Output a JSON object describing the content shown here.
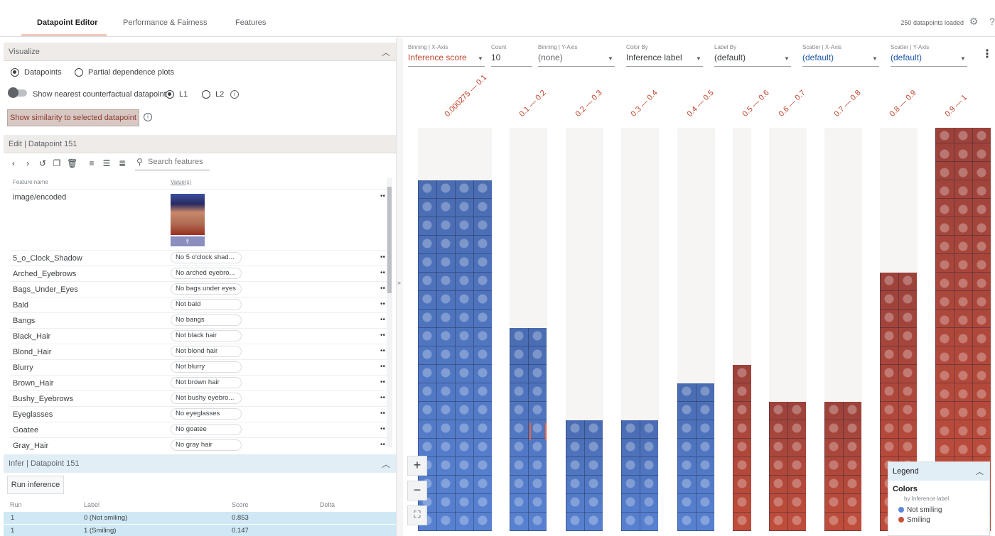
{
  "tabs": [
    "Datapoint Editor",
    "Performance & Fairness",
    "Features"
  ],
  "header": {
    "loaded": "250 datapoints loaded"
  },
  "visualize": {
    "title": "Visualize",
    "mode_datapoints": "Datapoints",
    "mode_pdp": "Partial dependence plots",
    "nearest_label": "Show nearest counterfactual datapoint",
    "l1": "L1",
    "l2": "L2",
    "similarity_button": "Show similarity to selected datapoint"
  },
  "edit": {
    "title": "Edit | Datapoint 151",
    "search_placeholder": "Search features",
    "col_name": "Feature name",
    "col_value": "Value(s)",
    "image_feature": "image/encoded",
    "features": [
      {
        "name": "5_o_Clock_Shadow",
        "value": "No 5 o'clock shad..."
      },
      {
        "name": "Arched_Eyebrows",
        "value": "No arched eyebro..."
      },
      {
        "name": "Bags_Under_Eyes",
        "value": "No bags under eyes"
      },
      {
        "name": "Bald",
        "value": "Not bald"
      },
      {
        "name": "Bangs",
        "value": "No bangs"
      },
      {
        "name": "Black_Hair",
        "value": "Not black hair"
      },
      {
        "name": "Blond_Hair",
        "value": "Not blond hair"
      },
      {
        "name": "Blurry",
        "value": "Not blurry"
      },
      {
        "name": "Brown_Hair",
        "value": "Not brown hair"
      },
      {
        "name": "Bushy_Eyebrows",
        "value": "Not bushy eyebro..."
      },
      {
        "name": "Eyeglasses",
        "value": "No eyeglasses"
      },
      {
        "name": "Goatee",
        "value": "No goatee"
      },
      {
        "name": "Gray_Hair",
        "value": "No gray hair"
      }
    ]
  },
  "infer": {
    "title": "Infer | Datapoint 151",
    "run_button": "Run inference",
    "cols": [
      "Run",
      "Label",
      "Score",
      "Delta"
    ],
    "rows": [
      {
        "run": "1",
        "label": "0 (Not smiling)",
        "score": "0.853"
      },
      {
        "run": "1",
        "label": "1 (Smiling)",
        "score": "0.147"
      }
    ]
  },
  "controls": [
    {
      "label": "Binning | X-Axis",
      "value": "Inference score",
      "style": "accent"
    },
    {
      "label": "Count",
      "value": "10",
      "style": "plain"
    },
    {
      "label": "Binning | Y-Axis",
      "value": "(none)",
      "style": "muted"
    },
    {
      "label": "Color By",
      "value": "Inference label",
      "style": "plain"
    },
    {
      "label": "Label By",
      "value": "(default)",
      "style": "plain"
    },
    {
      "label": "Scatter | X-Axis",
      "value": "(default)",
      "style": "blue"
    },
    {
      "label": "Scatter | Y-Axis",
      "value": "(default)",
      "style": "blue"
    }
  ],
  "bins": [
    {
      "label": "0.000275 — 0.1",
      "count": 74,
      "color": "blue"
    },
    {
      "label": "0.1 — 0.2",
      "count": 22,
      "color": "blue"
    },
    {
      "label": "0.2 — 0.3",
      "count": 12,
      "color": "blue"
    },
    {
      "label": "0.3 — 0.4",
      "count": 12,
      "color": "blue"
    },
    {
      "label": "0.4 — 0.5",
      "count": 15,
      "color": "blue"
    },
    {
      "label": "0.5 — 0.6",
      "count": 9,
      "color": "red"
    },
    {
      "label": "0.6 — 0.7",
      "count": 14,
      "color": "red"
    },
    {
      "label": "0.7 — 0.8",
      "count": 14,
      "color": "red"
    },
    {
      "label": "0.8 — 0.9",
      "count": 28,
      "color": "red"
    },
    {
      "label": "0.9 — 1",
      "count": 113,
      "color": "red"
    }
  ],
  "colors": {
    "blue": "#5b87d9",
    "red": "#c9503b",
    "accent": "#c0432a"
  },
  "legend": {
    "title": "Legend",
    "colors_title": "Colors",
    "by": "by Inference label",
    "items": [
      {
        "label": "Not smiling",
        "color": "#5b87d9"
      },
      {
        "label": "Smiling",
        "color": "#c9503b"
      }
    ]
  }
}
